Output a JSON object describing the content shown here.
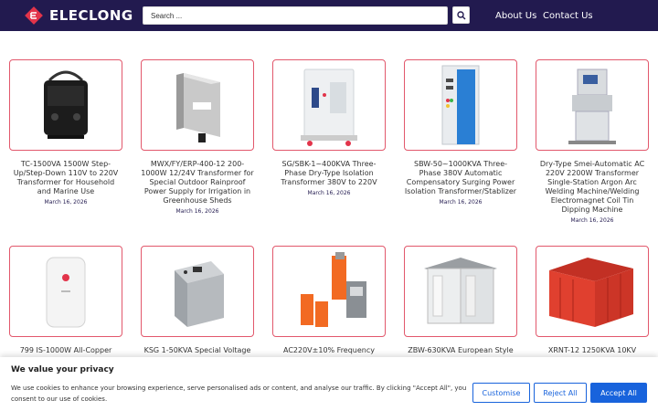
{
  "header": {
    "brand": "ELECLONG",
    "search_placeholder": "Search ...",
    "nav": [
      "About Us",
      "Contact Us"
    ]
  },
  "products": [
    {
      "title": "TC-1500VA 1500W Step-Up/Step-Down 110V to 220V Transformer for Household and Marine Use",
      "date": "March 16, 2026",
      "icon": "black-transformer-icon"
    },
    {
      "title": "MWX/FY/ERP-400-12 200-1000W 12/24V Transformer for Special Outdoor Rainproof Power Supply for Irrigation in Greenhouse Sheds",
      "date": "March 16, 2026",
      "icon": "power-supply-icon"
    },
    {
      "title": "SG/SBK-1~400KVA Three-Phase Dry-Type Isolation Transformer 380V to 220V",
      "date": "March 16, 2026",
      "icon": "isolation-transformer-icon"
    },
    {
      "title": "SBW-50~1000KVA Three-Phase 380V Automatic Compensatory Surging Power Isolation Transformer/Stablizer",
      "date": "March 16, 2026",
      "icon": "stabilizer-cabinet-icon"
    },
    {
      "title": "Dry-Type Smei-Automatic AC 220V 2200W Transformer Single-Station Argon Arc Welding Machine/Welding Electromagnet Coil Tin Dipping Machine",
      "date": "March 16, 2026",
      "icon": "welding-machine-icon"
    },
    {
      "title": "799 IS-1000W All-Copper",
      "date": "",
      "icon": "wall-regulator-icon"
    },
    {
      "title": "KSG 1-50KVA Special Voltage",
      "date": "",
      "icon": "steel-transformer-icon"
    },
    {
      "title": "AC220V±10% Frequency",
      "date": "",
      "icon": "test-equipment-icon"
    },
    {
      "title": "ZBW-630KVA European Style",
      "date": "",
      "icon": "substation-white-icon"
    },
    {
      "title": "XRNT-12 1250KVA 10KV",
      "date": "",
      "icon": "substation-red-icon"
    }
  ],
  "cookie": {
    "title": "We value your privacy",
    "text": "We use cookies to enhance your browsing experience, serve personalised ads or content, and analyse our traffic. By clicking \"Accept All\", you consent to our use of cookies.",
    "customise": "Customise",
    "reject": "Reject All",
    "accept": "Accept All"
  },
  "colors": {
    "header_bg": "#221a4f",
    "brand_red": "#e2344a",
    "accent_blue": "#1863dc",
    "card_border": "#e2586c"
  }
}
